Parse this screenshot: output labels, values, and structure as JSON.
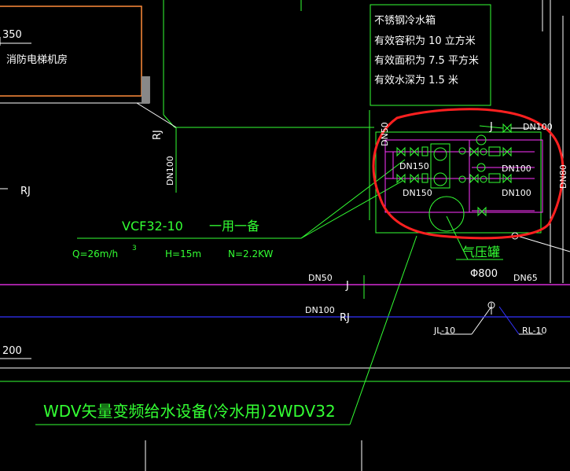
{
  "tank": {
    "title": "不锈钢冷水箱",
    "volume": "有效容积为  10  立方米",
    "area": "有效面积为  7.5  平方米",
    "depth": "有效水深为  1.5  米"
  },
  "room": {
    "elev": "350",
    "name": "消防电梯机房"
  },
  "labels": {
    "rj1": "RJ",
    "rj2": "RJ",
    "rj3": "RJ",
    "dn100_v": "DN100",
    "dn50_v": "DN50",
    "dn100_tr": "DN100",
    "dn150_a": "DN150",
    "dn150_b": "DN150",
    "dn100_a": "DN100",
    "dn100_b": "DN100",
    "dn80_v": "DN80",
    "dn50_h": "DN50",
    "dn65": "DN65",
    "dn100_h": "DN100",
    "j1": "J",
    "j2": "J",
    "jl10": "JL-10",
    "rl10": "RL-10",
    "elev2": "200"
  },
  "equipment": {
    "pump_model": "VCF32-10",
    "pump_note": "一用一备",
    "flow": "Q=26m/h",
    "flow_sup": "3",
    "head": "H=15m",
    "power": "N=2.2KW",
    "vessel": "气压罐",
    "vessel_dia": "Φ800"
  },
  "footer": {
    "title": "WDV矢量变频给水设备(冷水用)",
    "model": "2WDV32"
  },
  "colors": {
    "background": "#000000",
    "green": "#33ff33",
    "magenta": "#ff33ff",
    "blue": "#3333ff",
    "orange": "#ff8c3a",
    "red": "#ff2020",
    "white": "#ffffff"
  }
}
